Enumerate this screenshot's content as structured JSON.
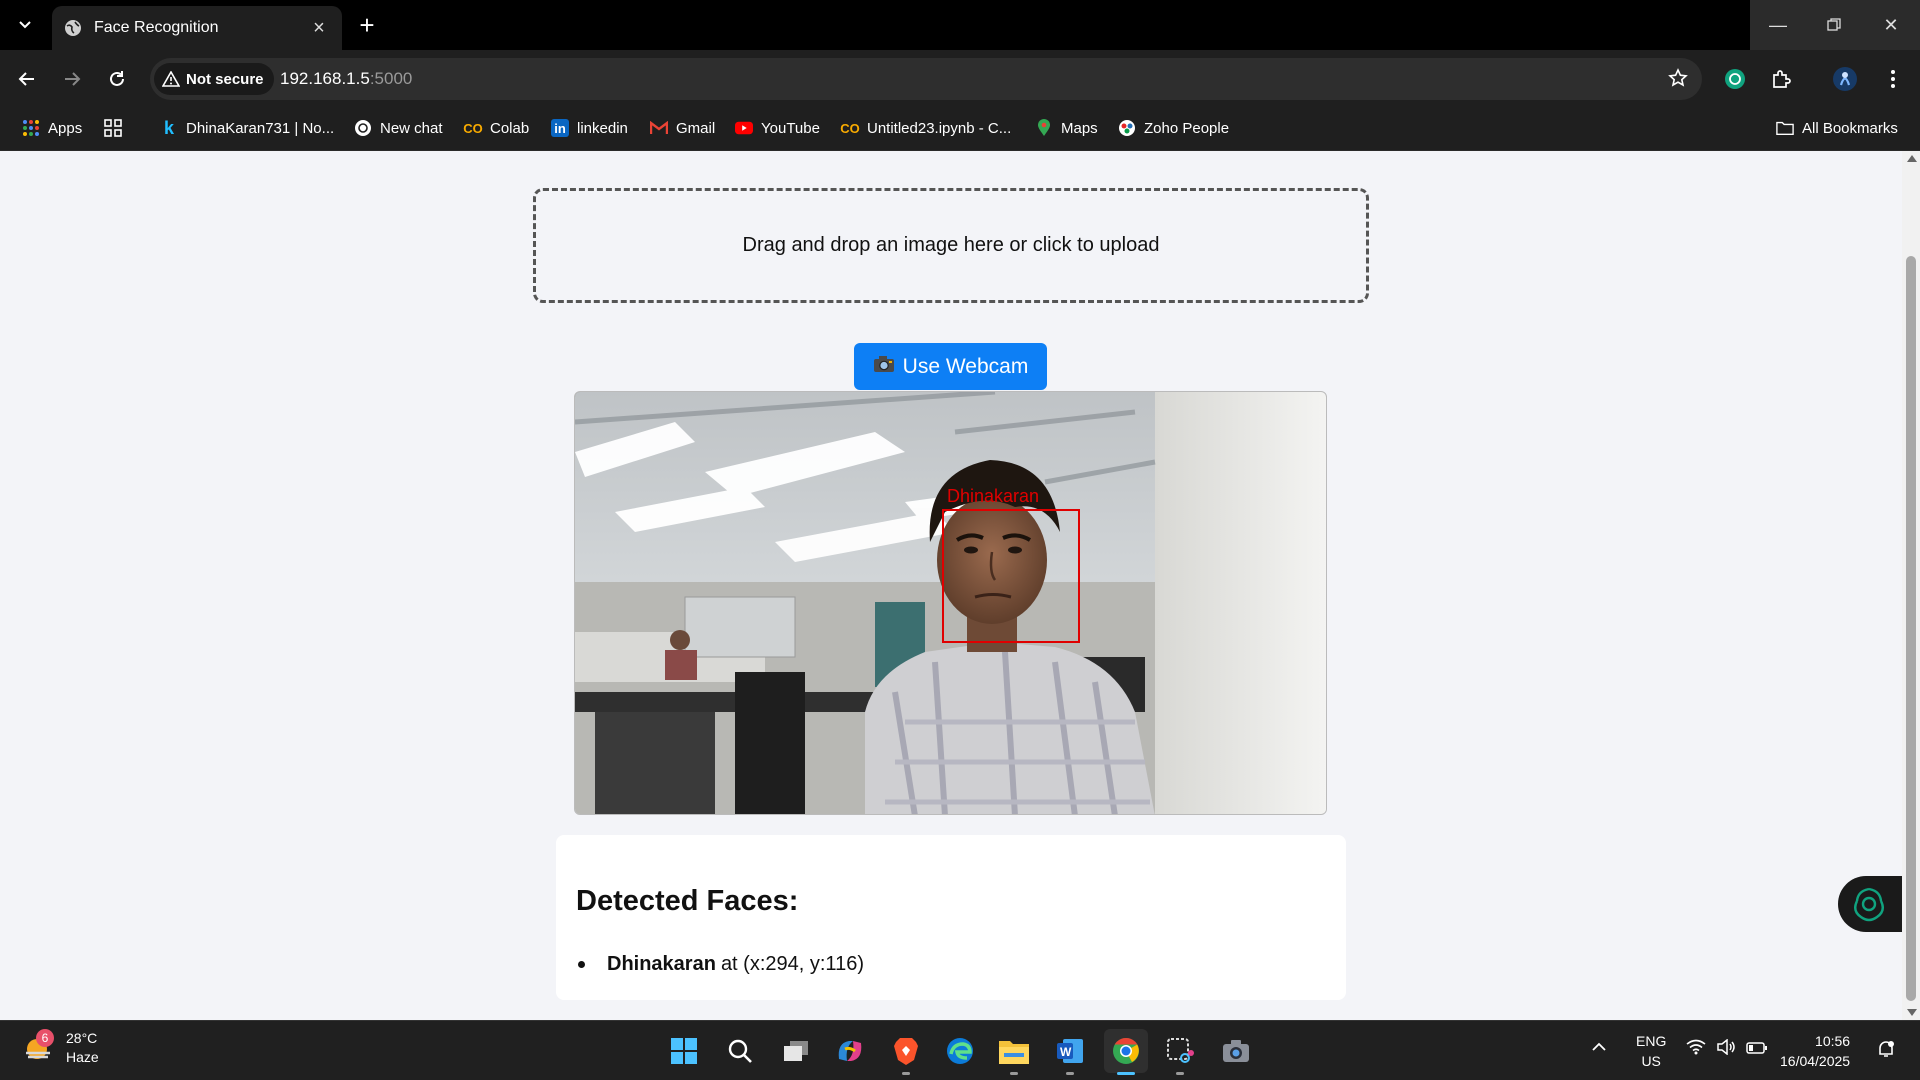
{
  "browser": {
    "tab_title": "Face Recognition",
    "security_label": "Not secure",
    "url_host": "192.168.1.5",
    "url_port": ":5000",
    "bookmarks": [
      {
        "label": "Apps",
        "icon": "apps-grid-icon"
      },
      {
        "label": "",
        "icon": "tab-groups-icon"
      },
      {
        "label": "DhinaKaran731 | No...",
        "icon": "kaggle-icon"
      },
      {
        "label": "New chat",
        "icon": "chatgpt-icon"
      },
      {
        "label": "Colab",
        "icon": "colab-icon"
      },
      {
        "label": "linkedin",
        "icon": "linkedin-icon"
      },
      {
        "label": "Gmail",
        "icon": "gmail-icon"
      },
      {
        "label": "YouTube",
        "icon": "youtube-icon"
      },
      {
        "label": "Untitled23.ipynb - C...",
        "icon": "colab-icon"
      },
      {
        "label": "Maps",
        "icon": "maps-icon"
      },
      {
        "label": "Zoho People",
        "icon": "zoho-icon"
      }
    ],
    "all_bookmarks_label": "All Bookmarks"
  },
  "page": {
    "dropzone_text": "Drag and drop an image here or click to upload",
    "webcam_button_label": "Use Webcam",
    "webcam_button_icon": "camera-icon",
    "detected_face_label": "Dhinakaran",
    "results_heading": "Detected Faces:",
    "detected_faces": [
      {
        "name": "Dhinakaran",
        "position_text": "at (x:294, y:116)"
      }
    ]
  },
  "taskbar": {
    "weather_alerts": "6",
    "temperature": "28°C",
    "condition": "Haze",
    "language_line1": "ENG",
    "language_line2": "US",
    "time": "10:56",
    "date": "16/04/2025"
  },
  "colors": {
    "accent": "#0d7ff5",
    "detection": "#e00000"
  }
}
